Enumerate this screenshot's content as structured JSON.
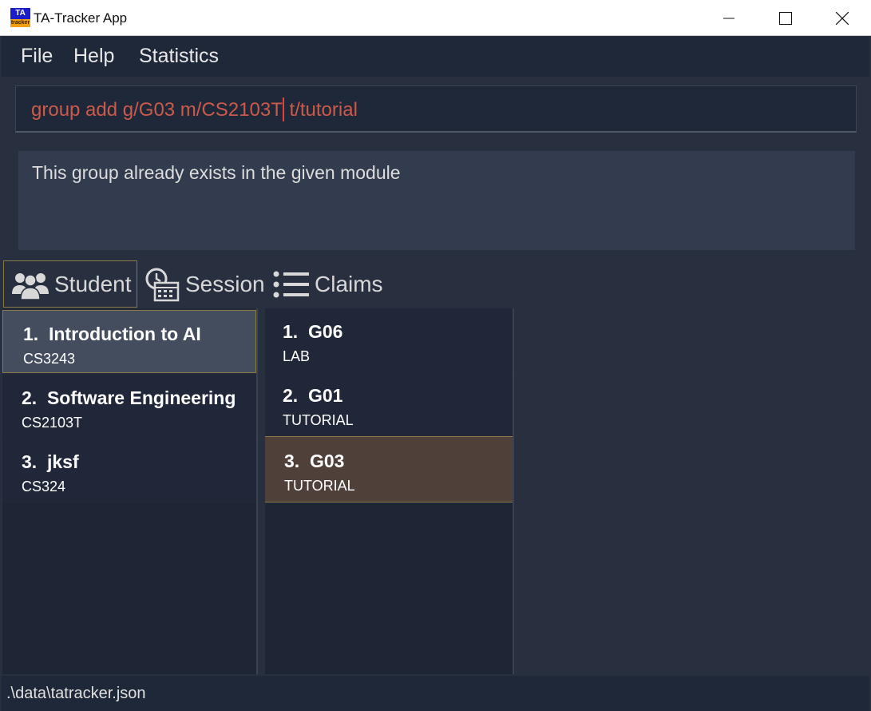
{
  "window": {
    "title": "TA-Tracker App",
    "logo_top": "TA",
    "logo_bottom": "tracker"
  },
  "menu": [
    "File",
    "Help",
    "Statistics"
  ],
  "command": {
    "value_before_caret": "group add g/G03 m/CS2103T",
    "value_after_caret": " t/tutorial"
  },
  "result": {
    "message": "This group already exists in the given module"
  },
  "tabs": {
    "student": "Student",
    "session": "Session",
    "claims": "Claims"
  },
  "modules": [
    {
      "index": "1.",
      "name": "Introduction to AI",
      "code": "CS3243"
    },
    {
      "index": "2.",
      "name": "Software Engineering",
      "code": "CS2103T"
    },
    {
      "index": "3.",
      "name": "jksf",
      "code": "CS324"
    }
  ],
  "groups": [
    {
      "index": "1.",
      "name": "G06",
      "type": "LAB"
    },
    {
      "index": "2.",
      "name": "G01",
      "type": "TUTORIAL"
    },
    {
      "index": "3.",
      "name": "G03",
      "type": "TUTORIAL"
    }
  ],
  "status": {
    "path": ".\\data\\tatracker.json"
  },
  "colors": {
    "background": "#283040",
    "command_text": "#cc5a4a",
    "selected_module": "#434d5e",
    "selected_group": "#50403a",
    "highlight_border": "#8a7a4a"
  }
}
